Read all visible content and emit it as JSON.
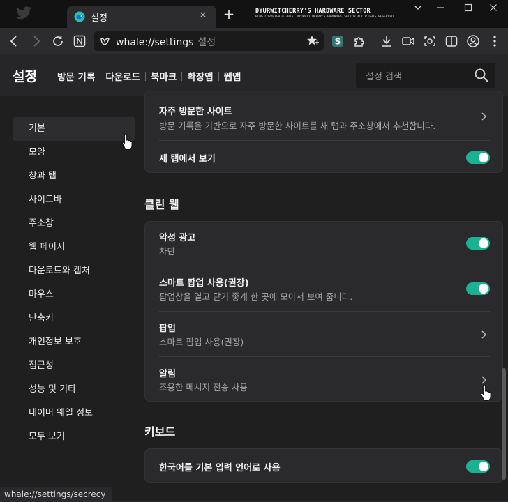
{
  "titlebar": {
    "tab_title": "설정",
    "watermark_title": "DYURWITCHERRY'S HARDWARE SECTOR",
    "watermark_sub": "BLOG COPYRIGHT© 2015. DYURWITCHERRY'S HARDWARE SECTOR ALL RIGHTS RESERVED.",
    "new_tab_label": "+",
    "close_tab_label": "✕"
  },
  "toolbar": {
    "url": "whale://settings",
    "url_hint": "설정",
    "icons": [
      "back-icon",
      "forward-icon",
      "reload-icon",
      "naver-n-icon",
      "omni-whale-icon",
      "favorite-icon",
      "extension-s-icon",
      "puzzle-icon",
      "download-icon",
      "video-icon",
      "capture-icon",
      "sidebar-split-icon",
      "profile-icon",
      "menu-more-icon"
    ]
  },
  "header": {
    "title": "설정",
    "nav": [
      "방문 기록",
      "다운로드",
      "북마크",
      "확장앱",
      "웹앱"
    ],
    "search_placeholder": "설정 검색"
  },
  "sidebar": {
    "items": [
      {
        "label": "기본",
        "active": true
      },
      {
        "label": "모양"
      },
      {
        "label": "창과 탭"
      },
      {
        "label": "사이드바"
      },
      {
        "label": "주소창"
      },
      {
        "label": "웹 페이지"
      },
      {
        "label": "다운로드와 캡처"
      },
      {
        "label": "마우스"
      },
      {
        "label": "단축키"
      },
      {
        "label": "개인정보 보호"
      },
      {
        "label": "접근성"
      },
      {
        "label": "성능 및 기타"
      },
      {
        "label": "네이버 웨일 정보"
      },
      {
        "label": "모두 보기"
      }
    ]
  },
  "main": {
    "card_top": {
      "rows": [
        {
          "title": "자주 방문한 사이트",
          "subtitle": "방문 기록을 기반으로 자주 방문한 사이트를 새 탭과 주소창에서 추천합니다.",
          "control": "chevron"
        },
        {
          "title": "새 탭에서 보기",
          "control": "toggle",
          "on": true
        }
      ]
    },
    "clean_web": {
      "title": "클린 웹",
      "rows": [
        {
          "title": "악성 광고",
          "subtitle": "차단",
          "control": "toggle",
          "on": true
        },
        {
          "title": "스마트 팝업 사용(권장)",
          "subtitle": "팝업창을 열고 닫기 좋게 한 곳에 모아서 보여 줍니다.",
          "control": "toggle",
          "on": true
        },
        {
          "title": "팝업",
          "subtitle": "스마트 팝업 사용(권장)",
          "control": "chevron"
        },
        {
          "title": "알림",
          "subtitle": "조용한 메시지 전송 사용",
          "control": "chevron"
        }
      ]
    },
    "keyboard": {
      "title": "키보드",
      "rows": [
        {
          "title": "한국어를 기본 입력 언어로 사용",
          "control": "toggle",
          "on": true
        }
      ]
    }
  },
  "statusbar": {
    "text": "whale://settings/secrecy"
  },
  "colors": {
    "accent_toggle": "#19b394",
    "background": "#1f1f20",
    "card": "#2a2a2c"
  }
}
